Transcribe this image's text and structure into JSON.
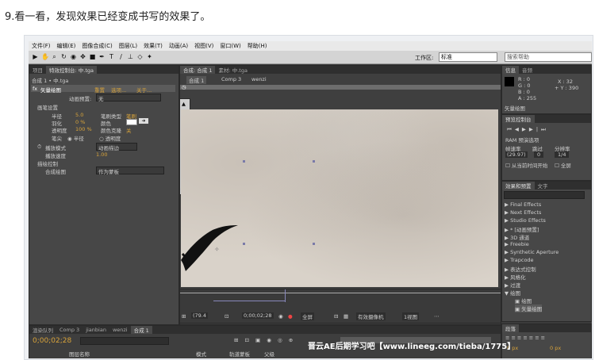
{
  "caption": "9.看一看，发现效果已经变成书写的效果了。",
  "menu": [
    "文件(F)",
    "编辑(E)",
    "图像合成(C)",
    "图层(L)",
    "效果(T)",
    "动画(A)",
    "视图(V)",
    "窗口(W)",
    "帮助(H)"
  ],
  "toolbar": {
    "workspace_label": "工作区:",
    "workspace_value": "标准",
    "search_placeholder": "搜索帮助"
  },
  "left_panel": {
    "tabs": [
      "项目",
      "特效控制台: 中.tga"
    ],
    "path": "合成 1 • 中.tga",
    "effect_name": "矢量绘图",
    "effect_links": [
      "重置",
      "选项...",
      "关于..."
    ],
    "preset_label": "动画预置:",
    "preset_value": "无",
    "brush_settings": "画笔设置",
    "radius_label": "半径",
    "radius_value": "5.0",
    "feather_label": "羽化",
    "feather_value": "0 %",
    "opacity_label": "透明度",
    "opacity_value": "100 %",
    "brush_type_label": "笔刷类型",
    "brush_type_value": "笔刷",
    "color_label": "颜色",
    "color_effect_label": "颜色克隆",
    "color_effect_value": "关",
    "hardness_label": "笔尖",
    "radius_check": "半径",
    "opacity_check": "透明度",
    "playback_mode_label": "播放模式",
    "playback_mode_value": "动画描边",
    "playback_speed_label": "播放速度",
    "playback_speed_value": "1.00",
    "paint_control": "描绘控制",
    "composite_label": "合成绘图",
    "composite_value": "作为蒙板"
  },
  "viewer": {
    "tabs": [
      "合成: 合成 1",
      "素材: 中.tga"
    ],
    "breadcrumbs": [
      "合成 1",
      "Comp 3",
      "wenzi"
    ],
    "zoom": "(79.4",
    "timecode": "0;00;02;28",
    "quality": "全屏",
    "camera": "有效摄像机",
    "view": "1视图"
  },
  "info": {
    "tabs": [
      "信息",
      "音频"
    ],
    "r": "R : 0",
    "g": "G : 0",
    "b": "B : 0",
    "a": "A : 255",
    "x": "X : 32",
    "y": "+ Y : 390",
    "layer": "矢量绘图"
  },
  "preview": {
    "title": "预览控制台",
    "ram": "RAM 预演选项",
    "fps_label": "帧速率",
    "skip_label": "跳过",
    "res_label": "分辨率",
    "fps": "(29.97)",
    "skip": "0",
    "res": "1/4",
    "from_current": "从当前时间开始",
    "fullscreen": "全屏"
  },
  "effects": {
    "tabs": [
      "效果和预置",
      "文字"
    ],
    "items": [
      "Final Effects",
      "Next Effects",
      "Studio Effects",
      "* [动画预置]",
      "3D 通道",
      "Freebie",
      "Synthetic Aperture",
      "Trapcode",
      "表达式控制",
      "风格化",
      "过渡",
      "绘图",
      "绘图",
      "矢量绘图"
    ]
  },
  "timeline": {
    "tabs": [
      "渲染队列",
      "Comp 3",
      "jianbian",
      "wenzi",
      "合成 1"
    ],
    "timecode": "0;00;02;28",
    "col_name": "图层名称",
    "col_mode": "模式",
    "col_track": "轨道蒙板",
    "col_parent": "父级"
  },
  "paragraph": {
    "tab": "段落",
    "px1": "0 px",
    "px2": "0 px"
  },
  "watermark": "晋云AE后期学习吧【www.lineeg.com/tieba/1775】"
}
